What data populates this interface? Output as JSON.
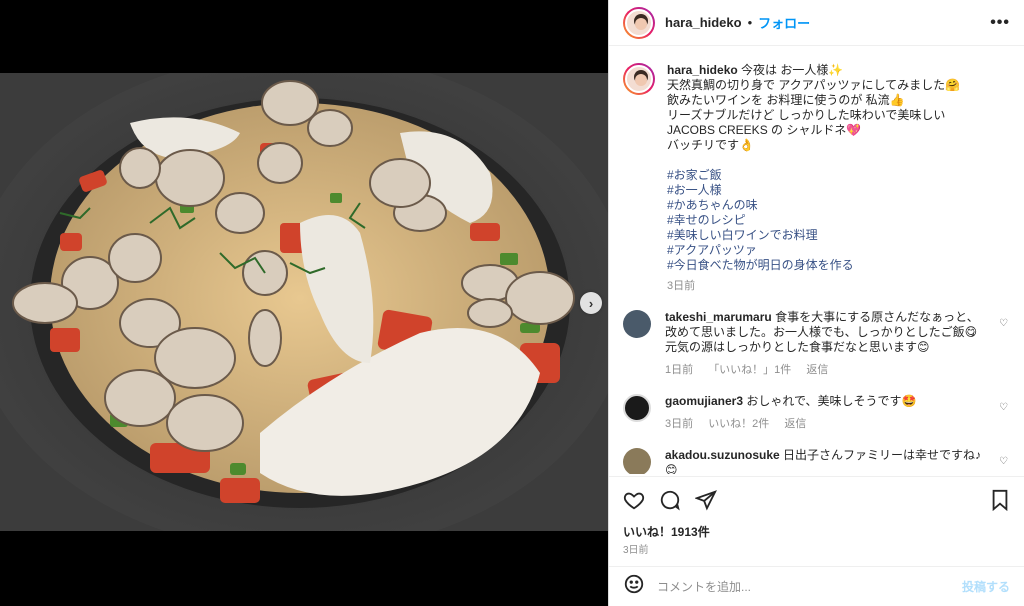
{
  "post": {
    "username": "hara_hideko",
    "dot": "•",
    "follow_label": "フォロー",
    "more_label": "•••"
  },
  "caption": {
    "username": "hara_hideko",
    "lines": [
      "今夜は お一人様✨",
      "天然真鯛の切り身で アクアパッツァにしてみました🤗",
      "飲みたいワインを お料理に使うのが 私流👍",
      "リーズナブルだけど しっかりした味わいで美味しい JACOBS CREEKS の シャルドネ💖",
      "バッチリです👌"
    ],
    "hashtags": [
      "#お家ご飯",
      "#お一人様",
      "#かあちゃんの味",
      "#幸せのレシピ",
      "#美味しい白ワインでお料理",
      "#アクアパッツァ",
      "#今日食べた物が明日の身体を作る"
    ],
    "time": "3日前"
  },
  "comments": [
    {
      "username": "takeshi_marumaru",
      "text": "食事を大事にする原さんだなぁっと、改めて思いました。お一人様でも、しっかりとしたご飯😋元気の源はしっかりとした食事だなと思います😊",
      "time": "1日前",
      "likes": "「いいね！」1件",
      "reply": "返信",
      "avatar_color": "#4a5a6a"
    },
    {
      "username": "gaomujianer3",
      "text": "おしゃれで、美味しそうです🤩",
      "time": "3日前",
      "likes": "いいね！2件",
      "reply": "返信",
      "avatar_color": "#1a1a1a"
    },
    {
      "username": "akadou.suzunosuke",
      "text": "日出子さんファミリーは幸せですね♪😊",
      "time": "",
      "likes": "",
      "reply": "",
      "avatar_color": "#8a7a5a"
    }
  ],
  "actions": {
    "likes_count": "いいね！1913件",
    "posted_time": "3日前"
  },
  "add_comment": {
    "placeholder": "コメントを追加...",
    "post_label": "投稿する"
  },
  "colors": {
    "accent": "#0095f6",
    "hashtag": "#385185",
    "post_disabled": "#b2dffc"
  }
}
